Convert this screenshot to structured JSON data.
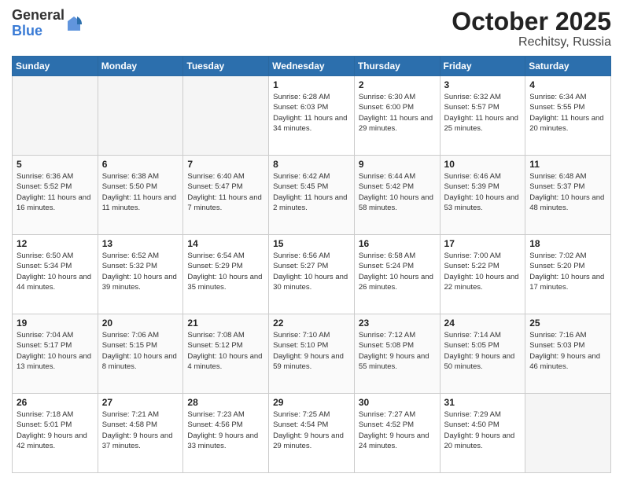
{
  "header": {
    "logo_general": "General",
    "logo_blue": "Blue",
    "title": "October 2025",
    "location": "Rechitsy, Russia"
  },
  "weekdays": [
    "Sunday",
    "Monday",
    "Tuesday",
    "Wednesday",
    "Thursday",
    "Friday",
    "Saturday"
  ],
  "weeks": [
    [
      {
        "day": "",
        "info": ""
      },
      {
        "day": "",
        "info": ""
      },
      {
        "day": "",
        "info": ""
      },
      {
        "day": "1",
        "info": "Sunrise: 6:28 AM\nSunset: 6:03 PM\nDaylight: 11 hours\nand 34 minutes."
      },
      {
        "day": "2",
        "info": "Sunrise: 6:30 AM\nSunset: 6:00 PM\nDaylight: 11 hours\nand 29 minutes."
      },
      {
        "day": "3",
        "info": "Sunrise: 6:32 AM\nSunset: 5:57 PM\nDaylight: 11 hours\nand 25 minutes."
      },
      {
        "day": "4",
        "info": "Sunrise: 6:34 AM\nSunset: 5:55 PM\nDaylight: 11 hours\nand 20 minutes."
      }
    ],
    [
      {
        "day": "5",
        "info": "Sunrise: 6:36 AM\nSunset: 5:52 PM\nDaylight: 11 hours\nand 16 minutes."
      },
      {
        "day": "6",
        "info": "Sunrise: 6:38 AM\nSunset: 5:50 PM\nDaylight: 11 hours\nand 11 minutes."
      },
      {
        "day": "7",
        "info": "Sunrise: 6:40 AM\nSunset: 5:47 PM\nDaylight: 11 hours\nand 7 minutes."
      },
      {
        "day": "8",
        "info": "Sunrise: 6:42 AM\nSunset: 5:45 PM\nDaylight: 11 hours\nand 2 minutes."
      },
      {
        "day": "9",
        "info": "Sunrise: 6:44 AM\nSunset: 5:42 PM\nDaylight: 10 hours\nand 58 minutes."
      },
      {
        "day": "10",
        "info": "Sunrise: 6:46 AM\nSunset: 5:39 PM\nDaylight: 10 hours\nand 53 minutes."
      },
      {
        "day": "11",
        "info": "Sunrise: 6:48 AM\nSunset: 5:37 PM\nDaylight: 10 hours\nand 48 minutes."
      }
    ],
    [
      {
        "day": "12",
        "info": "Sunrise: 6:50 AM\nSunset: 5:34 PM\nDaylight: 10 hours\nand 44 minutes."
      },
      {
        "day": "13",
        "info": "Sunrise: 6:52 AM\nSunset: 5:32 PM\nDaylight: 10 hours\nand 39 minutes."
      },
      {
        "day": "14",
        "info": "Sunrise: 6:54 AM\nSunset: 5:29 PM\nDaylight: 10 hours\nand 35 minutes."
      },
      {
        "day": "15",
        "info": "Sunrise: 6:56 AM\nSunset: 5:27 PM\nDaylight: 10 hours\nand 30 minutes."
      },
      {
        "day": "16",
        "info": "Sunrise: 6:58 AM\nSunset: 5:24 PM\nDaylight: 10 hours\nand 26 minutes."
      },
      {
        "day": "17",
        "info": "Sunrise: 7:00 AM\nSunset: 5:22 PM\nDaylight: 10 hours\nand 22 minutes."
      },
      {
        "day": "18",
        "info": "Sunrise: 7:02 AM\nSunset: 5:20 PM\nDaylight: 10 hours\nand 17 minutes."
      }
    ],
    [
      {
        "day": "19",
        "info": "Sunrise: 7:04 AM\nSunset: 5:17 PM\nDaylight: 10 hours\nand 13 minutes."
      },
      {
        "day": "20",
        "info": "Sunrise: 7:06 AM\nSunset: 5:15 PM\nDaylight: 10 hours\nand 8 minutes."
      },
      {
        "day": "21",
        "info": "Sunrise: 7:08 AM\nSunset: 5:12 PM\nDaylight: 10 hours\nand 4 minutes."
      },
      {
        "day": "22",
        "info": "Sunrise: 7:10 AM\nSunset: 5:10 PM\nDaylight: 9 hours\nand 59 minutes."
      },
      {
        "day": "23",
        "info": "Sunrise: 7:12 AM\nSunset: 5:08 PM\nDaylight: 9 hours\nand 55 minutes."
      },
      {
        "day": "24",
        "info": "Sunrise: 7:14 AM\nSunset: 5:05 PM\nDaylight: 9 hours\nand 50 minutes."
      },
      {
        "day": "25",
        "info": "Sunrise: 7:16 AM\nSunset: 5:03 PM\nDaylight: 9 hours\nand 46 minutes."
      }
    ],
    [
      {
        "day": "26",
        "info": "Sunrise: 7:18 AM\nSunset: 5:01 PM\nDaylight: 9 hours\nand 42 minutes."
      },
      {
        "day": "27",
        "info": "Sunrise: 7:21 AM\nSunset: 4:58 PM\nDaylight: 9 hours\nand 37 minutes."
      },
      {
        "day": "28",
        "info": "Sunrise: 7:23 AM\nSunset: 4:56 PM\nDaylight: 9 hours\nand 33 minutes."
      },
      {
        "day": "29",
        "info": "Sunrise: 7:25 AM\nSunset: 4:54 PM\nDaylight: 9 hours\nand 29 minutes."
      },
      {
        "day": "30",
        "info": "Sunrise: 7:27 AM\nSunset: 4:52 PM\nDaylight: 9 hours\nand 24 minutes."
      },
      {
        "day": "31",
        "info": "Sunrise: 7:29 AM\nSunset: 4:50 PM\nDaylight: 9 hours\nand 20 minutes."
      },
      {
        "day": "",
        "info": ""
      }
    ]
  ]
}
